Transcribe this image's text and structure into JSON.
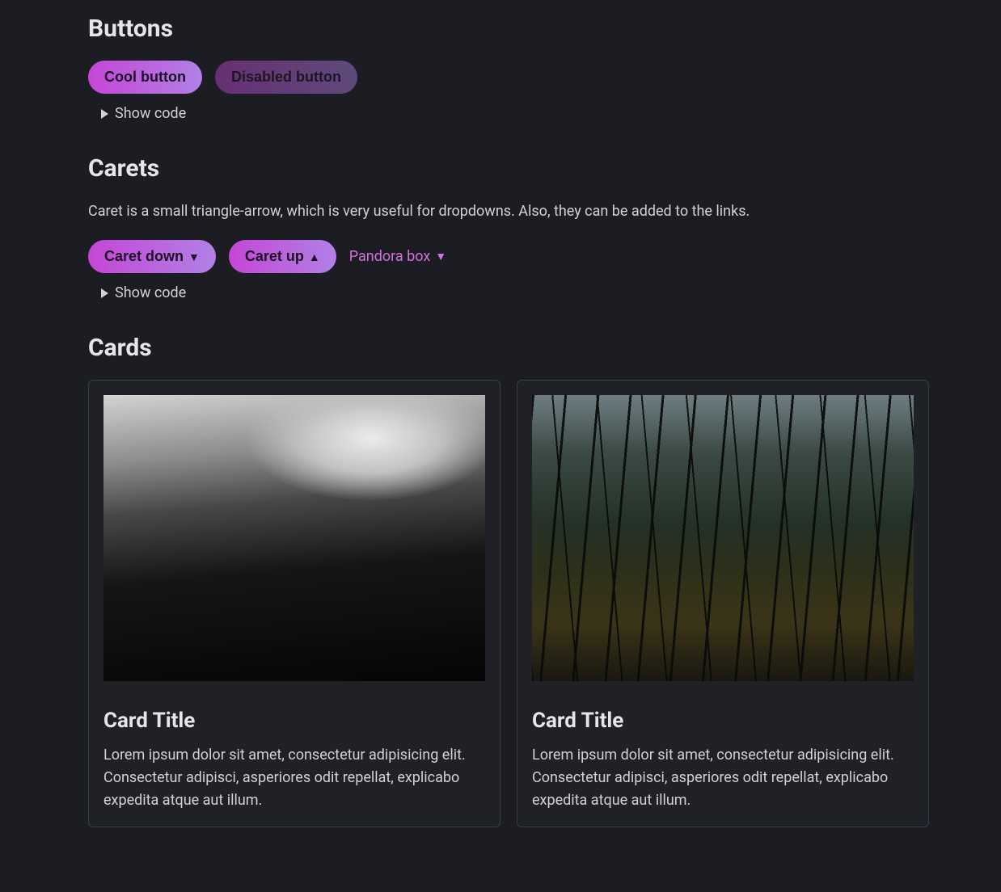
{
  "sections": {
    "buttons": {
      "heading": "Buttons",
      "cool_label": "Cool button",
      "disabled_label": "Disabled button",
      "show_code": "Show code"
    },
    "carets": {
      "heading": "Carets",
      "description": "Caret is a small triangle-arrow, which is very useful for dropdowns. Also, they can be added to the links.",
      "down_label": "Caret down",
      "up_label": "Caret up",
      "link_label": "Pandora box",
      "caret_down_glyph": "▼",
      "caret_up_glyph": "▲",
      "show_code": "Show code"
    },
    "cards": {
      "heading": "Cards",
      "items": [
        {
          "image": "mountain",
          "title": "Card Title",
          "body": "Lorem ipsum dolor sit amet, consectetur adipisicing elit. Consectetur adipisci, asperiores odit repellat, explicabo expedita atque aut illum."
        },
        {
          "image": "forest",
          "title": "Card Title",
          "body": "Lorem ipsum dolor sit amet, consectetur adipisicing elit. Consectetur adipisci, asperiores odit repellat, explicabo expedita atque aut illum."
        }
      ]
    }
  },
  "colors": {
    "accent_start": "#c546d6",
    "accent_end": "#b181e6",
    "link": "#d66de0",
    "background": "#1b1d22"
  }
}
